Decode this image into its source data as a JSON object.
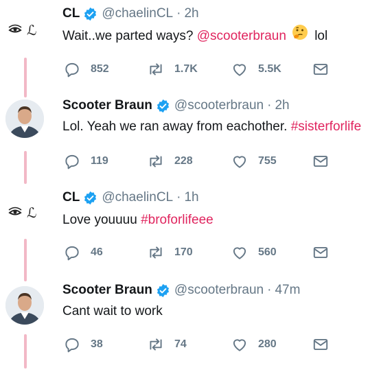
{
  "tweets": [
    {
      "author": "CL",
      "handle": "@chaelinCL",
      "time": "2h",
      "text_parts": [
        "Wait..we parted ways? ",
        "@scooterbraun",
        " lol"
      ],
      "replies": "852",
      "retweets": "1.7K",
      "likes": "5.5K",
      "avatar_glyph": "ℒ"
    },
    {
      "author": "Scooter Braun",
      "handle": "@scooterbraun",
      "time": "2h",
      "text_parts": [
        "Lol. Yeah we ran away from eachother. ",
        "#sisterforlife"
      ],
      "replies": "119",
      "retweets": "228",
      "likes": "755"
    },
    {
      "author": "CL",
      "handle": "@chaelinCL",
      "time": "1h",
      "text_parts": [
        "Love youuuu ",
        "#broforlifeee"
      ],
      "replies": "46",
      "retweets": "170",
      "likes": "560",
      "avatar_glyph": "ℒ"
    },
    {
      "author": "Scooter Braun",
      "handle": "@scooterbraun",
      "time": "47m",
      "text_parts": [
        "Cant wait to work"
      ],
      "replies": "38",
      "retweets": "74",
      "likes": "280"
    }
  ],
  "icons": {
    "reply": "reply-icon",
    "retweet": "retweet-icon",
    "like": "heart-icon",
    "dm": "mail-icon",
    "verified": "verified-badge-icon",
    "emoji": "thinking-face-emoji"
  },
  "colors": {
    "accent": "#e0245e",
    "muted": "#657786",
    "verified": "#1da1f2",
    "thread": "#f2b8c6"
  }
}
